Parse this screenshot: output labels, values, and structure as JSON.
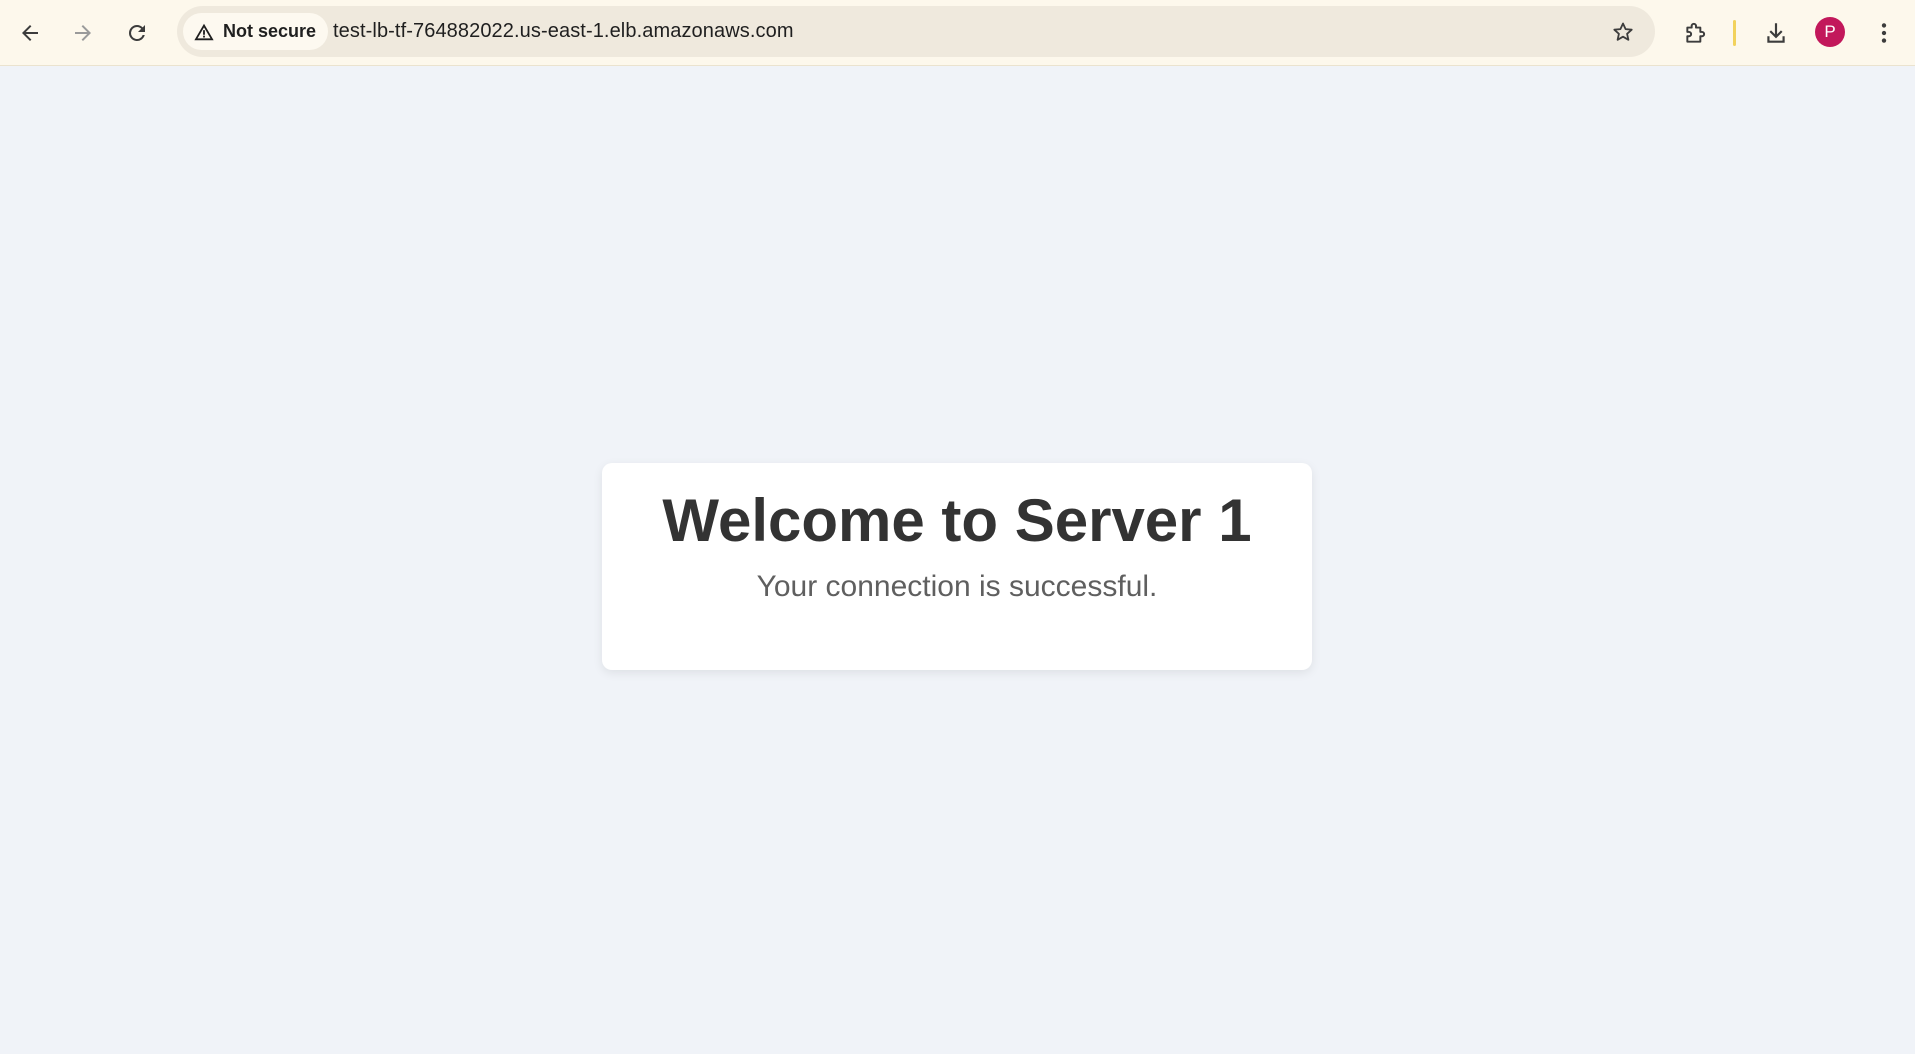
{
  "browser": {
    "security_label": "Not secure",
    "url": "test-lb-tf-764882022.us-east-1.elb.amazonaws.com",
    "profile_initial": "P",
    "profile_color": "#c2185b",
    "icons": {
      "back": "arrow-left-icon",
      "forward": "arrow-right-icon",
      "reload": "reload-icon",
      "security": "warning-triangle-icon",
      "bookmark": "star-icon",
      "extensions": "puzzle-icon",
      "downloads": "download-icon",
      "menu": "kebab-menu-icon"
    }
  },
  "page": {
    "background": "#f0f3f8",
    "title": "Welcome to Server 1",
    "subtitle": "Your connection is successful."
  }
}
